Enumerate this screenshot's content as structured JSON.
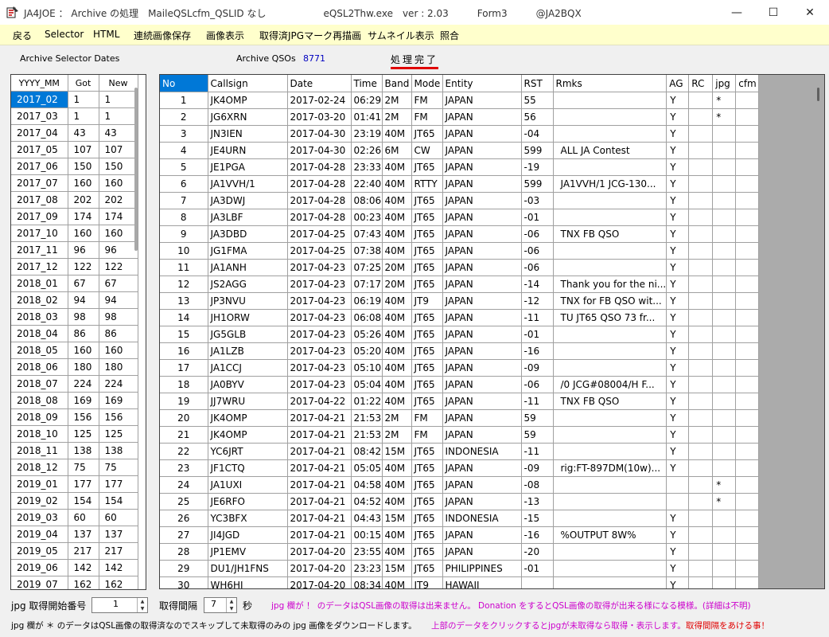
{
  "window": {
    "title": "JA4JOE ： Archive の処理　MaileQSLcfm_QSLID なし　　　　　　eQSL2Thw.exe　ver : 2.03　　　Form3　　　@JA2BQX",
    "minimize": "—",
    "maximize": "☐",
    "close": "✕"
  },
  "menu": [
    "戻る",
    "Selector",
    "HTML",
    "連続画像保存",
    "画像表示",
    "取得済JPGマーク再描画",
    "サムネイル表示",
    "照合"
  ],
  "labels": {
    "archive_selector_dates": "Archive Selector Dates",
    "archive_qsos": "Archive QSOs",
    "archive_qsos_count": "8771",
    "status": "処理完了"
  },
  "left_grid": {
    "columns": [
      "YYYY_MM",
      "Got",
      "New"
    ],
    "rows": [
      [
        "2017_02",
        "1",
        "1"
      ],
      [
        "2017_03",
        "1",
        "1"
      ],
      [
        "2017_04",
        "43",
        "43"
      ],
      [
        "2017_05",
        "107",
        "107"
      ],
      [
        "2017_06",
        "150",
        "150"
      ],
      [
        "2017_07",
        "160",
        "160"
      ],
      [
        "2017_08",
        "202",
        "202"
      ],
      [
        "2017_09",
        "174",
        "174"
      ],
      [
        "2017_10",
        "160",
        "160"
      ],
      [
        "2017_11",
        "96",
        "96"
      ],
      [
        "2017_12",
        "122",
        "122"
      ],
      [
        "2018_01",
        "67",
        "67"
      ],
      [
        "2018_02",
        "94",
        "94"
      ],
      [
        "2018_03",
        "98",
        "98"
      ],
      [
        "2018_04",
        "86",
        "86"
      ],
      [
        "2018_05",
        "160",
        "160"
      ],
      [
        "2018_06",
        "180",
        "180"
      ],
      [
        "2018_07",
        "224",
        "224"
      ],
      [
        "2018_08",
        "169",
        "169"
      ],
      [
        "2018_09",
        "156",
        "156"
      ],
      [
        "2018_10",
        "125",
        "125"
      ],
      [
        "2018_11",
        "138",
        "138"
      ],
      [
        "2018_12",
        "75",
        "75"
      ],
      [
        "2019_01",
        "177",
        "177"
      ],
      [
        "2019_02",
        "154",
        "154"
      ],
      [
        "2019_03",
        "60",
        "60"
      ],
      [
        "2019_04",
        "137",
        "137"
      ],
      [
        "2019_05",
        "217",
        "217"
      ],
      [
        "2019_06",
        "142",
        "142"
      ],
      [
        "2019_07",
        "162",
        "162"
      ]
    ]
  },
  "main_grid": {
    "columns": [
      "No",
      "Callsign",
      "Date",
      "Time",
      "Band",
      "Mode",
      "Entity",
      "RST",
      "Rmks",
      "AG",
      "RC",
      "jpg",
      "cfm"
    ],
    "rows": [
      [
        "1",
        "JK4OMP",
        "2017-02-24",
        "06:29",
        "2M",
        "FM",
        "JAPAN",
        "55",
        "",
        "Y",
        "",
        "*",
        ""
      ],
      [
        "2",
        "JG6XRN",
        "2017-03-20",
        "01:41",
        "2M",
        "FM",
        "JAPAN",
        "56",
        "",
        "Y",
        "",
        "*",
        ""
      ],
      [
        "3",
        "JN3IEN",
        "2017-04-30",
        "23:19",
        "40M",
        "JT65",
        "JAPAN",
        "-04",
        "",
        "Y",
        "",
        "",
        ""
      ],
      [
        "4",
        "JE4URN",
        "2017-04-30",
        "02:26",
        "6M",
        "CW",
        "JAPAN",
        "599",
        "ALL JA Contest",
        "Y",
        "",
        "",
        ""
      ],
      [
        "5",
        "JE1PGA",
        "2017-04-28",
        "23:33",
        "40M",
        "JT65",
        "JAPAN",
        "-19",
        "",
        "Y",
        "",
        "",
        ""
      ],
      [
        "6",
        "JA1VVH/1",
        "2017-04-28",
        "22:40",
        "40M",
        "RTTY",
        "JAPAN",
        "599",
        "JA1VVH/1 JCG-130...",
        "Y",
        "",
        "",
        ""
      ],
      [
        "7",
        "JA3DWJ",
        "2017-04-28",
        "08:06",
        "40M",
        "JT65",
        "JAPAN",
        "-03",
        "",
        "Y",
        "",
        "",
        ""
      ],
      [
        "8",
        "JA3LBF",
        "2017-04-28",
        "00:23",
        "40M",
        "JT65",
        "JAPAN",
        "-01",
        "",
        "Y",
        "",
        "",
        ""
      ],
      [
        "9",
        "JA3DBD",
        "2017-04-25",
        "07:43",
        "40M",
        "JT65",
        "JAPAN",
        "-06",
        "TNX FB QSO",
        "Y",
        "",
        "",
        ""
      ],
      [
        "10",
        "JG1FMA",
        "2017-04-25",
        "07:38",
        "40M",
        "JT65",
        "JAPAN",
        "-06",
        "",
        "Y",
        "",
        "",
        ""
      ],
      [
        "11",
        "JA1ANH",
        "2017-04-23",
        "07:25",
        "20M",
        "JT65",
        "JAPAN",
        "-06",
        "",
        "Y",
        "",
        "",
        ""
      ],
      [
        "12",
        "JS2AGG",
        "2017-04-23",
        "07:17",
        "20M",
        "JT65",
        "JAPAN",
        "-14",
        "Thank you for the ni...",
        "Y",
        "",
        "",
        ""
      ],
      [
        "13",
        "JP3NVU",
        "2017-04-23",
        "06:19",
        "40M",
        "JT9",
        "JAPAN",
        "-12",
        "TNX for FB QSO wit...",
        "Y",
        "",
        "",
        ""
      ],
      [
        "14",
        "JH1ORW",
        "2017-04-23",
        "06:08",
        "40M",
        "JT65",
        "JAPAN",
        "-11",
        "TU JT65 QSO 73 fr...",
        "Y",
        "",
        "",
        ""
      ],
      [
        "15",
        "JG5GLB",
        "2017-04-23",
        "05:26",
        "40M",
        "JT65",
        "JAPAN",
        "-01",
        "",
        "Y",
        "",
        "",
        ""
      ],
      [
        "16",
        "JA1LZB",
        "2017-04-23",
        "05:20",
        "40M",
        "JT65",
        "JAPAN",
        "-16",
        "",
        "Y",
        "",
        "",
        ""
      ],
      [
        "17",
        "JA1CCJ",
        "2017-04-23",
        "05:10",
        "40M",
        "JT65",
        "JAPAN",
        "-09",
        "",
        "Y",
        "",
        "",
        ""
      ],
      [
        "18",
        "JA0BYV",
        "2017-04-23",
        "05:04",
        "40M",
        "JT65",
        "JAPAN",
        "-06",
        "/0 JCG#08004/H  F...",
        "Y",
        "",
        "",
        ""
      ],
      [
        "19",
        "JJ7WRU",
        "2017-04-22",
        "01:22",
        "40M",
        "JT65",
        "JAPAN",
        "-11",
        "TNX FB QSO",
        "Y",
        "",
        "",
        ""
      ],
      [
        "20",
        "JK4OMP",
        "2017-04-21",
        "21:53",
        "2M",
        "FM",
        "JAPAN",
        "59",
        "",
        "Y",
        "",
        "",
        ""
      ],
      [
        "21",
        "JK4OMP",
        "2017-04-21",
        "21:53",
        "2M",
        "FM",
        "JAPAN",
        "59",
        "",
        "Y",
        "",
        "",
        ""
      ],
      [
        "22",
        "YC6JRT",
        "2017-04-21",
        "08:42",
        "15M",
        "JT65",
        "INDONESIA",
        "-11",
        "",
        "Y",
        "",
        "",
        ""
      ],
      [
        "23",
        "JF1CTQ",
        "2017-04-21",
        "05:05",
        "40M",
        "JT65",
        "JAPAN",
        "-09",
        "rig:FT-897DM(10w)...",
        "Y",
        "",
        "",
        ""
      ],
      [
        "24",
        "JA1UXI",
        "2017-04-21",
        "04:58",
        "40M",
        "JT65",
        "JAPAN",
        "-08",
        "",
        "",
        "",
        "*",
        ""
      ],
      [
        "25",
        "JE6RFO",
        "2017-04-21",
        "04:52",
        "40M",
        "JT65",
        "JAPAN",
        "-13",
        "",
        "",
        "",
        "*",
        ""
      ],
      [
        "26",
        "YC3BFX",
        "2017-04-21",
        "04:43",
        "15M",
        "JT65",
        "INDONESIA",
        "-15",
        "",
        "Y",
        "",
        "",
        ""
      ],
      [
        "27",
        "JI4JGD",
        "2017-04-21",
        "00:15",
        "40M",
        "JT65",
        "JAPAN",
        "-16",
        "%OUTPUT 8W%",
        "Y",
        "",
        "",
        ""
      ],
      [
        "28",
        "JP1EMV",
        "2017-04-20",
        "23:55",
        "40M",
        "JT65",
        "JAPAN",
        "-20",
        "",
        "Y",
        "",
        "",
        ""
      ],
      [
        "29",
        "DU1/JH1FNS",
        "2017-04-20",
        "23:23",
        "15M",
        "JT65",
        "PHILIPPINES",
        "-01",
        "",
        "Y",
        "",
        "",
        ""
      ],
      [
        "30",
        "WH6HI",
        "2017-04-20",
        "08:34",
        "40M",
        "JT9",
        "HAWAII",
        "",
        "",
        "Y",
        "",
        "",
        ""
      ]
    ]
  },
  "bottom": {
    "jpg_start_label": "jpg 取得開始番号",
    "jpg_start_value": "1",
    "interval_label": "取得間隔",
    "interval_value": "7",
    "seconds_label": "秒",
    "note_magenta": "jpg 欄が ！ のデータはQSL画像の取得は出来ません。 Donation をするとQSL画像の取得が出来る様になる模様。(詳細は不明)",
    "note_black": "jpg 欄が ＊ のデータはQSL画像の取得済なのでスキップして未取得のみの jpg 画像をダウンロードします。",
    "note_click": "上部のデータをクリックするとjpgが未取得なら取得・表示します。",
    "note_red": "取得間隔をあける事！"
  },
  "colors": {
    "menubar_bg": "#ffffcc",
    "selection": "#0078d7",
    "count_blue": "#0000c0",
    "magenta": "#cc00cc",
    "red": "#e00000"
  }
}
